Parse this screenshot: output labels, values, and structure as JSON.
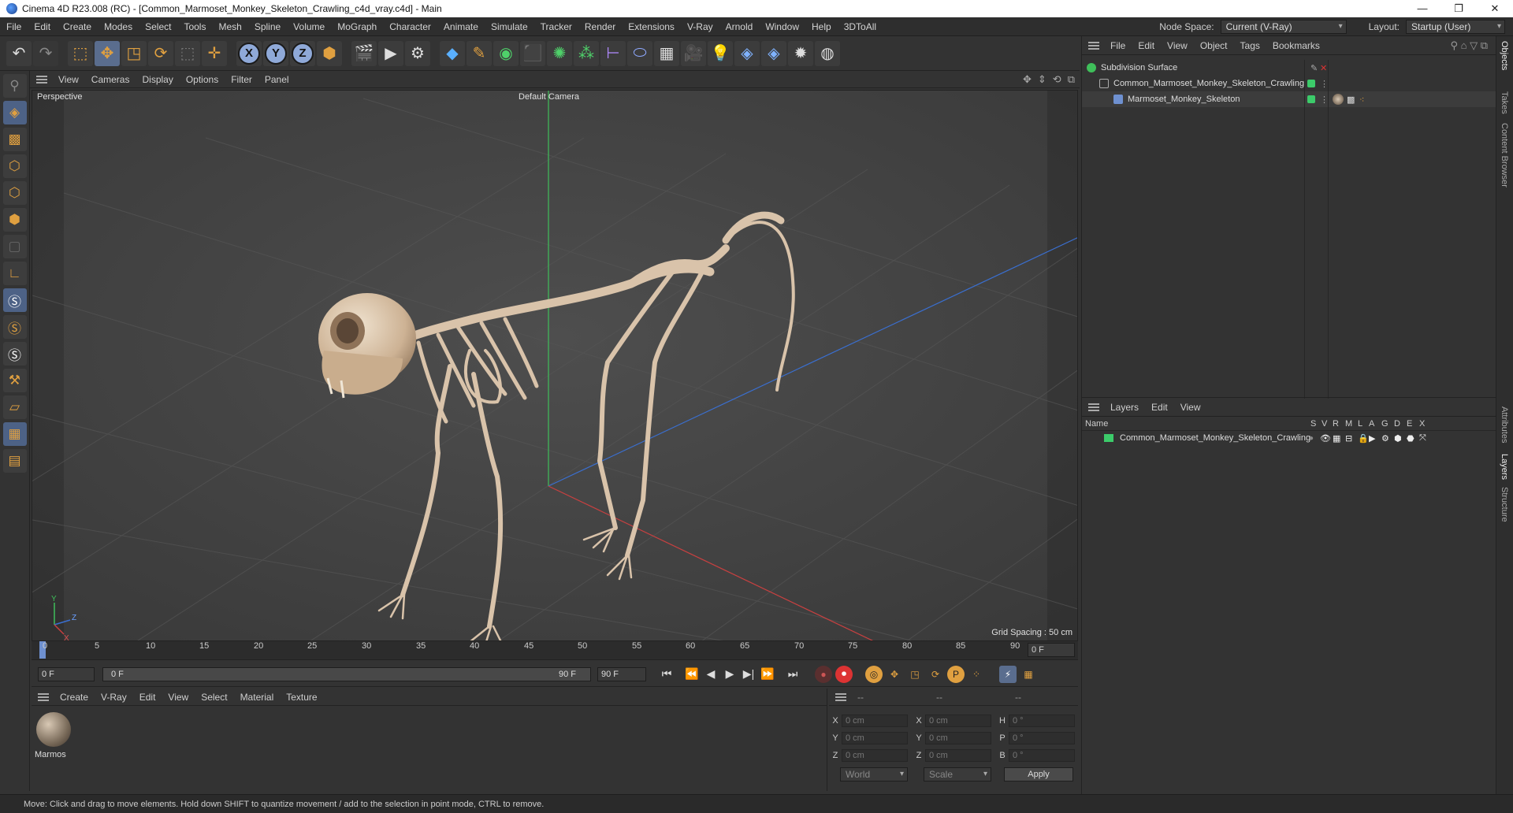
{
  "window": {
    "title": "Cinema 4D R23.008 (RC) - [Common_Marmoset_Monkey_Skeleton_Crawling_c4d_vray.c4d] - Main",
    "minimize": "—",
    "maximize": "❐",
    "close": "✕"
  },
  "menubar": {
    "items": [
      "File",
      "Edit",
      "Create",
      "Modes",
      "Select",
      "Tools",
      "Mesh",
      "Spline",
      "Volume",
      "MoGraph",
      "Character",
      "Animate",
      "Simulate",
      "Tracker",
      "Render",
      "Extensions",
      "V-Ray",
      "Arnold",
      "Window",
      "Help",
      "3DToAll"
    ],
    "node_space_label": "Node Space:",
    "node_space_value": "Current (V-Ray)",
    "layout_label": "Layout:",
    "layout_value": "Startup (User)"
  },
  "toolbar": {
    "axis_x": "X",
    "axis_y": "Y",
    "axis_z": "Z"
  },
  "viewport": {
    "menu": [
      "View",
      "Cameras",
      "Display",
      "Options",
      "Filter",
      "Panel"
    ],
    "view_name": "Perspective",
    "camera": "Default Camera",
    "grid_spacing": "Grid Spacing : 50 cm",
    "axis_y": "Y",
    "axis_z": "Z",
    "axis_x": "X"
  },
  "timeline": {
    "ticks": [
      "0",
      "5",
      "10",
      "15",
      "20",
      "25",
      "30",
      "35",
      "40",
      "45",
      "50",
      "55",
      "60",
      "65",
      "70",
      "75",
      "80",
      "85",
      "90"
    ],
    "current_frame": "0 F"
  },
  "transport": {
    "start": "0 F",
    "range_start": "0 F",
    "range_end": "90 F",
    "end": "90 F"
  },
  "material_manager": {
    "menu": [
      "Create",
      "V-Ray",
      "Edit",
      "View",
      "Select",
      "Material",
      "Texture"
    ],
    "material_name": "Marmos"
  },
  "coordinates": {
    "header": [
      "--",
      "--",
      "--"
    ],
    "pos_x": "0 cm",
    "pos_y": "0 cm",
    "pos_z": "0 cm",
    "size_x": "0 cm",
    "size_y": "0 cm",
    "size_z": "0 cm",
    "rot_h": "0 °",
    "rot_p": "0 °",
    "rot_b": "0 °",
    "labels": {
      "x": "X",
      "y": "Y",
      "z": "Z",
      "h": "H",
      "p": "P",
      "b": "B"
    },
    "mode": "World",
    "size_mode": "Scale",
    "apply": "Apply"
  },
  "object_manager": {
    "menu": [
      "File",
      "Edit",
      "View",
      "Object",
      "Tags",
      "Bookmarks"
    ],
    "objects": [
      {
        "name": "Subdivision Surface"
      },
      {
        "name": "Common_Marmoset_Monkey_Skeleton_Crawling"
      },
      {
        "name": "Marmoset_Monkey_Skeleton"
      }
    ]
  },
  "layer_manager": {
    "menu": [
      "Layers",
      "Edit",
      "View"
    ],
    "col_name": "Name",
    "cols": [
      "S",
      "V",
      "R",
      "M",
      "L",
      "A",
      "G",
      "D",
      "E",
      "X"
    ],
    "layers": [
      {
        "name": "Common_Marmoset_Monkey_Skeleton_Crawling",
        "color": "#3ccb6a"
      }
    ]
  },
  "side_tabs": [
    "Objects",
    "Takes",
    "Content Browser",
    "Attributes",
    "Layers",
    "Structure"
  ],
  "status": "Move: Click and drag to move elements. Hold down SHIFT to quantize movement / add to the selection in point mode, CTRL to remove.",
  "colors": {
    "accent": "#5a6d8e",
    "layer_green": "#3ccb6a",
    "bone": "#d9c3aa"
  }
}
